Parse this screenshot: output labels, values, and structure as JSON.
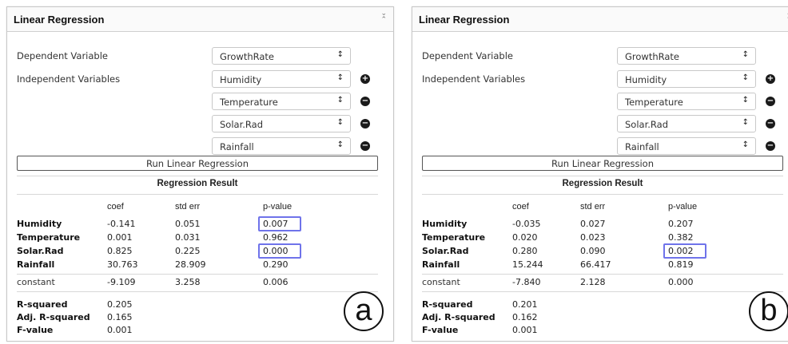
{
  "panels": [
    {
      "title": "Linear Regression",
      "dependent_label": "Dependent Variable",
      "independent_label": "Independent Variables",
      "dependent_value": "GrowthRate",
      "independent_values": [
        "Humidity",
        "Temperature",
        "Solar.Rad",
        "Rainfall"
      ],
      "run_button": "Run Linear Regression",
      "result_title": "Regression Result",
      "columns": [
        "coef",
        "std err",
        "p-value"
      ],
      "rows": [
        {
          "name": "Humidity",
          "coef": "-0.141",
          "stderr": "0.051",
          "p": "0.007",
          "highlight": true
        },
        {
          "name": "Temperature",
          "coef": "0.001",
          "stderr": "0.031",
          "p": "0.962",
          "highlight": false
        },
        {
          "name": "Solar.Rad",
          "coef": "0.825",
          "stderr": "0.225",
          "p": "0.000",
          "highlight": true
        },
        {
          "name": "Rainfall",
          "coef": "30.763",
          "stderr": "28.909",
          "p": "0.290",
          "highlight": false
        }
      ],
      "constant": {
        "name": "constant",
        "coef": "-9.109",
        "stderr": "3.258",
        "p": "0.006"
      },
      "stats": [
        {
          "name": "R-squared",
          "value": "0.205"
        },
        {
          "name": "Adj. R-squared",
          "value": "0.165"
        },
        {
          "name": "F-value",
          "value": "0.001"
        }
      ],
      "letter": "a"
    },
    {
      "title": "Linear Regression",
      "dependent_label": "Dependent Variable",
      "independent_label": "Independent Variables",
      "dependent_value": "GrowthRate",
      "independent_values": [
        "Humidity",
        "Temperature",
        "Solar.Rad",
        "Rainfall"
      ],
      "run_button": "Run Linear Regression",
      "result_title": "Regression Result",
      "columns": [
        "coef",
        "std err",
        "p-value"
      ],
      "rows": [
        {
          "name": "Humidity",
          "coef": "-0.035",
          "stderr": "0.027",
          "p": "0.207",
          "highlight": false
        },
        {
          "name": "Temperature",
          "coef": "0.020",
          "stderr": "0.023",
          "p": "0.382",
          "highlight": false
        },
        {
          "name": "Solar.Rad",
          "coef": "0.280",
          "stderr": "0.090",
          "p": "0.002",
          "highlight": true
        },
        {
          "name": "Rainfall",
          "coef": "15.244",
          "stderr": "66.417",
          "p": "0.819",
          "highlight": false
        }
      ],
      "constant": {
        "name": "constant",
        "coef": "-7.840",
        "stderr": "2.128",
        "p": "0.000"
      },
      "stats": [
        {
          "name": "R-squared",
          "value": "0.201"
        },
        {
          "name": "Adj. R-squared",
          "value": "0.162"
        },
        {
          "name": "F-value",
          "value": "0.001"
        }
      ],
      "letter": "b"
    }
  ],
  "colors": {
    "highlight": "#6f73ea",
    "border": "#c8c8c8"
  },
  "icons": {
    "select_arrow": "sort-arrows-icon",
    "add": "plus-circle-icon",
    "remove": "minus-circle-icon",
    "collapse": "collapse-chevrons-icon"
  }
}
